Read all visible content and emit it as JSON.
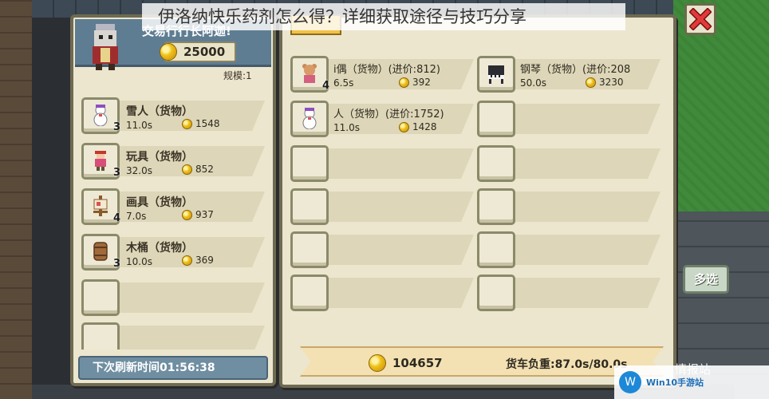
{
  "caption": "伊洛纳快乐药剂怎么得？详细获取途径与技巧分享",
  "merchant": {
    "name": "交易行行长阿迦!",
    "gold": "25000",
    "scale": "规模:1"
  },
  "left_goods": [
    {
      "name": "雪人（货物）",
      "qty": "3",
      "time": "11.0s",
      "price": "1548",
      "icon": "snowman-icon"
    },
    {
      "name": "玩具（货物）",
      "qty": "3",
      "time": "32.0s",
      "price": "852",
      "icon": "toy-icon"
    },
    {
      "name": "画具（货物）",
      "qty": "4",
      "time": "7.0s",
      "price": "937",
      "icon": "easel-icon"
    },
    {
      "name": "木桶（货物）",
      "qty": "3",
      "time": "10.0s",
      "price": "369",
      "icon": "barrel-icon"
    }
  ],
  "refresh": "下次刷新时间01:56:38",
  "trade": {
    "items": [
      {
        "title": "i偶（货物）(进价:812)",
        "qty": "4",
        "time": "6.5s",
        "price": "392",
        "icon": "doll-icon"
      },
      {
        "title": "钢琴（货物）(进价:208",
        "qty": "",
        "time": "50.0s",
        "price": "3230",
        "icon": "piano-icon"
      },
      {
        "title": "人（货物）(进价:1752)",
        "qty": "",
        "time": "11.0s",
        "price": "1428",
        "icon": "snowman-icon"
      }
    ],
    "money": "104657",
    "load": "货车负重:87.0s/80.0s"
  },
  "side": {
    "multi_select": "多选",
    "bottom_label": "情报站"
  },
  "watermark": {
    "logo": "W",
    "text": "Win10手游站"
  },
  "colors": {
    "panel": "#ece6cf",
    "panel_border": "#6f6a52",
    "header": "#5f7d92",
    "coin": "#f0c21c"
  }
}
